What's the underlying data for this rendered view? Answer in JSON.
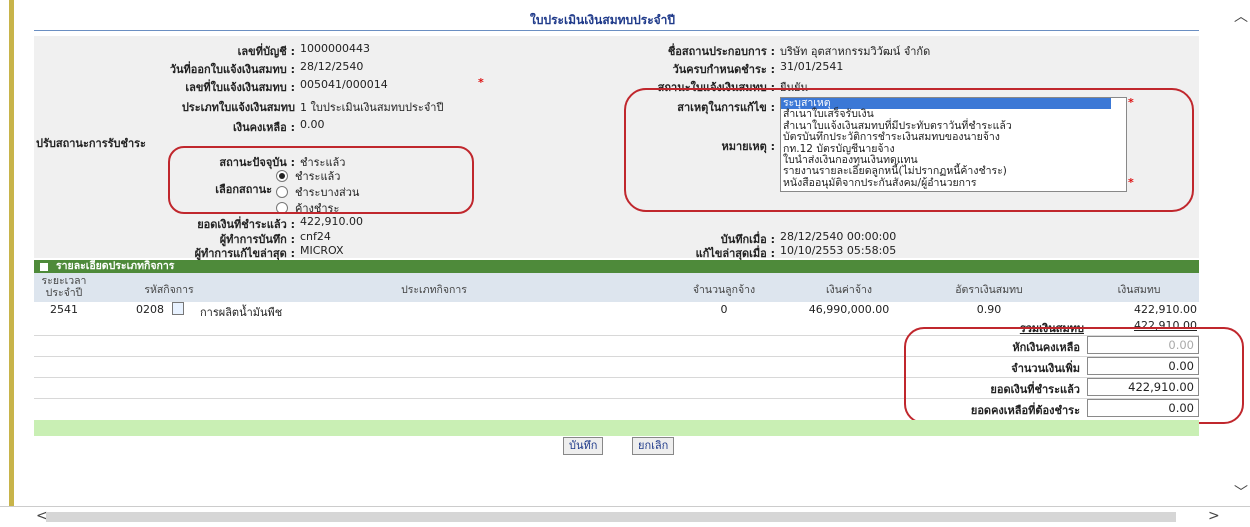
{
  "title": "ใบประเมินเงินสมทบประจำปี",
  "info": {
    "account_no_label": "เลขที่บัญชี :",
    "account_no": "1000000443",
    "issue_date_label": "วันที่ออกใบแจ้งเงินสมทบ :",
    "issue_date": "28/12/2540",
    "notice_no_label": "เลขที่ใบแจ้งเงินสมทบ :",
    "notice_no": "005041/000014",
    "notice_type_label": "ประเภทใบแจ้งเงินสมทบ",
    "notice_type": "1 ใบประเมินเงินสมทบประจำปี",
    "balance_label": "เงินคงเหลือ :",
    "balance": "0.00",
    "adjust_status_label": "ปรับสถานะการรับชำระ",
    "current_status_label": "สถานะปัจจุบัน :",
    "current_status": "ชำระแล้ว",
    "select_status_label": "เลือกสถานะ",
    "status_options": [
      "ชำระแล้ว",
      "ชำระบางส่วน",
      "ค้างชำระ"
    ],
    "paid_label": "ยอดเงินที่ชำระแล้ว :",
    "paid": "422,910.00",
    "recorder_label": "ผู้ทำการบันทึก :",
    "recorder": "cnf24",
    "last_editor_label": "ผู้ทำการแก้ไขล่าสุด :",
    "last_editor": "MICROX",
    "employer_label": "ชื่อสถานประกอบการ :",
    "employer": "บริษัท อุตสาหกรรมวิวัฒน์ จำกัด",
    "due_date_label": "วันครบกำหนดชำระ :",
    "due_date": "31/01/2541",
    "notice_status_label": "สถานะใบแจ้งเงินสมทบ :",
    "notice_status": "ยืนยัน",
    "reason_label": "สาเหตุในการแก้ไข :",
    "remark_label": "หมายเหตุ :",
    "reason_options": [
      "ระบุสาเหตุ",
      "สำเนาใบเสร็จรับเงิน",
      "สำเนาใบแจ้งเงินสมทบที่มีประทับตราวันที่ชำระแล้ว",
      "บัตรบันทึกประวัติการชำระเงินสมทบของนายจ้าง",
      "กท.12 บัตรบัญชีนายจ้าง",
      "ใบนำส่งเงินกองทุนเงินทดแทน",
      "รายงานรายละเอียดลูกหนี้(ไม่ปรากฏหนี้ค้างชำระ)",
      "หนังสืออนุมัติจากประกันสังคม/ผู้อำนวยการ"
    ],
    "saved_at_label": "บันทึกเมื่อ :",
    "saved_at": "28/12/2540 00:00:00",
    "edited_at_label": "แก้ไขล่าสุดเมื่อ :",
    "edited_at": "10/10/2553 05:58:05",
    "required_mark": "*"
  },
  "grid": {
    "header": "รายละเอียดประเภทกิจการ",
    "columns": {
      "period": "ระยะเวลาประจำปี",
      "code": "รหัสกิจการ",
      "type": "ประเภทกิจการ",
      "employees": "จำนวนลูกจ้าง",
      "wages": "เงินค่าจ้าง",
      "rate": "อัตราเงินสมทบ",
      "contribution": "เงินสมทบ"
    },
    "rows": [
      {
        "period": "2541",
        "code": "0208",
        "type": "การผลิตน้ำมันพืช",
        "employees": "0",
        "wages": "46,990,000.00",
        "rate": "0.90",
        "contribution": "422,910.00"
      }
    ],
    "total_label": "รวมเงินสมทบ",
    "total": "422,910.00"
  },
  "summary": {
    "deduct_balance_label": "หักเงินคงเหลือ",
    "deduct_balance": "0.00",
    "extra_label": "จำนวนเงินเพิ่ม",
    "extra": "0.00",
    "paid_label": "ยอดเงินที่ชำระแล้ว",
    "paid": "422,910.00",
    "outstanding_label": "ยอดคงเหลือที่ต้องชำระ",
    "outstanding": "0.00"
  },
  "buttons": {
    "save": "บันทึก",
    "cancel": "ยกเลิก"
  },
  "colors": {
    "header_green": "#4e8a3a",
    "title_blue": "#1f3a8a",
    "annotation_red": "#c0272d",
    "selected_blue": "#3b78d6"
  }
}
